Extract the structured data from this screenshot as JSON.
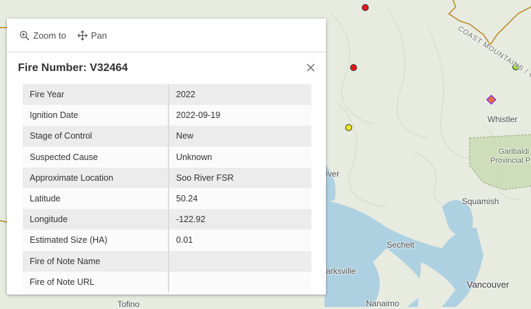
{
  "colors": {
    "fire_red": "#e21a1a",
    "fire_yellow": "#f2e21b",
    "fire_green": "#8bd61b",
    "fire_of_note": "#e86a4a",
    "water": "#aed1e2",
    "land": "#e8ebe0",
    "park": "#c9dcb4",
    "boundary": "#b8861b"
  },
  "map": {
    "labels": {
      "coast_mountains": "COAST MOUNTAINS / CHAÎNE",
      "whistler": "Whistler",
      "garibaldi": "Garibaldi",
      "provincial_park": "Provincial Pa",
      "squamish": "Squamish",
      "sechelt": "Sechelt",
      "vancouver": "Vancouver",
      "nanaimo": "Nanaimo",
      "parksville": "arksville",
      "river": "iver",
      "tofino": "Tofino"
    }
  },
  "popup": {
    "toolbar": {
      "zoom_to": "Zoom to",
      "pan": "Pan"
    },
    "title": "Fire Number: V32464",
    "rows": [
      {
        "key": "Fire Year",
        "value": "2022"
      },
      {
        "key": "Ignition Date",
        "value": "2022-09-19"
      },
      {
        "key": "Stage of Control",
        "value": "New"
      },
      {
        "key": "Suspected Cause",
        "value": "Unknown"
      },
      {
        "key": "Approximate Location",
        "value": "Soo River FSR"
      },
      {
        "key": "Latitude",
        "value": "50.24"
      },
      {
        "key": "Longitude",
        "value": "-122.92"
      },
      {
        "key": "Estimated Size (HA)",
        "value": "0.01"
      },
      {
        "key": "Fire of Note Name",
        "value": ""
      },
      {
        "key": "Fire of Note URL",
        "value": ""
      }
    ]
  }
}
